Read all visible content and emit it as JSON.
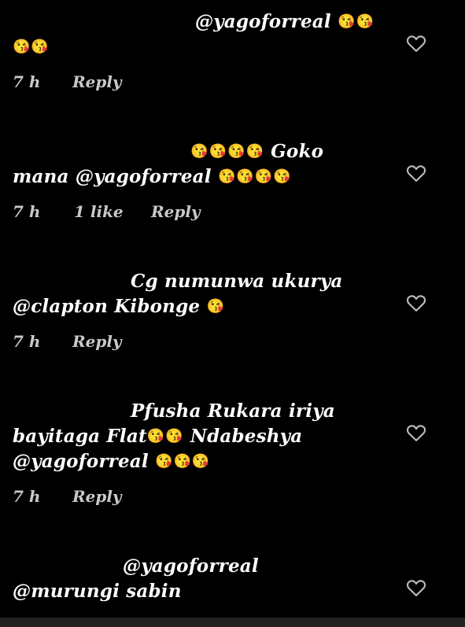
{
  "colors": {
    "background": "#000000",
    "text": "#ffffff",
    "meta_text": "#c9c9c9",
    "emoji": "#e040fb",
    "heart_outline": "#bdbdbd"
  },
  "comments": [
    {
      "lines": [
        {
          "text": "@yagoforreal",
          "emoji": "😘😘"
        },
        {
          "text": "",
          "emoji": "😘😘"
        }
      ],
      "time": "7 h",
      "likes": "",
      "reply_label": "Reply",
      "like_icon": "heart-outline-icon"
    },
    {
      "lines": [
        {
          "text": "",
          "emoji": "😘😘😘😘",
          "after": "Goko"
        },
        {
          "text": "mana @yagoforreal",
          "emoji": "😘😘😘😘"
        }
      ],
      "time": "7 h",
      "likes": "1 like",
      "reply_label": "Reply",
      "like_icon": "heart-outline-icon"
    },
    {
      "lines": [
        {
          "text": "Cg numunwa ukurya",
          "emoji": ""
        },
        {
          "text": "@clapton Kibonge",
          "emoji": "😘"
        }
      ],
      "time": "7 h",
      "likes": "",
      "reply_label": "Reply",
      "like_icon": "heart-outline-icon"
    },
    {
      "lines": [
        {
          "text": "Pfusha Rukara iriya",
          "emoji": ""
        },
        {
          "text": "bayitaga Flat",
          "emoji": "😘😘",
          "after": "Ndabeshya"
        },
        {
          "text": "@yagoforreal",
          "emoji": "😘😘😘"
        }
      ],
      "time": "7 h",
      "likes": "",
      "reply_label": "Reply",
      "like_icon": "heart-outline-icon"
    },
    {
      "lines": [
        {
          "text": "@yagoforreal",
          "emoji": ""
        },
        {
          "text": "@murungi sabin",
          "emoji": ""
        }
      ],
      "time": "",
      "likes": "",
      "reply_label": "",
      "like_icon": "heart-outline-icon"
    }
  ]
}
